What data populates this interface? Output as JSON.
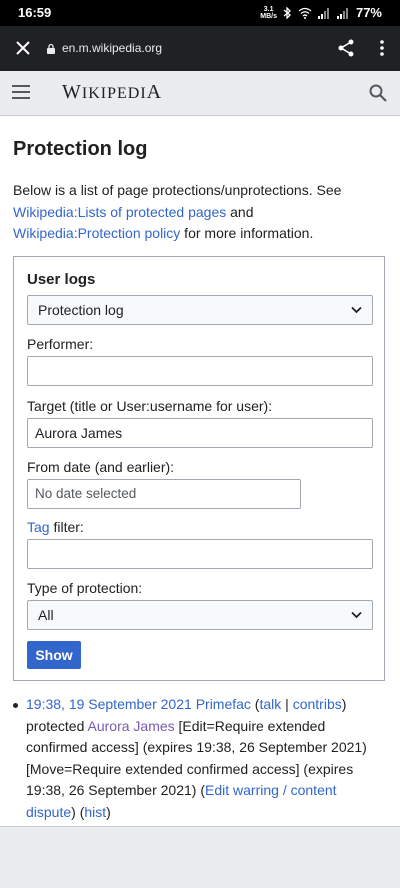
{
  "status_bar": {
    "time": "16:59",
    "net_speed_top": "3.1",
    "net_speed_bottom": "MB/s",
    "battery": "77%"
  },
  "browser": {
    "url": "en.m.wikipedia.org",
    "icons": [
      "close-icon",
      "lock-icon",
      "share-icon",
      "more-vert-icon"
    ]
  },
  "header": {
    "logo_w": "W",
    "logo_rest": "IKIPEDI",
    "logo_a": "A",
    "icons": [
      "hamburger-icon",
      "search-icon"
    ]
  },
  "page": {
    "title": "Protection log",
    "intro_text": "Below is a list of page protections/unprotections. See ",
    "intro_link1": "Wikipedia:Lists of protected pages",
    "intro_and": " and ",
    "intro_link2": "Wikipedia:Protection policy",
    "intro_end": " for more information."
  },
  "form": {
    "legend": "User logs",
    "log_type_value": "Protection log",
    "performer_label": "Performer:",
    "performer_value": "",
    "target_label": "Target (title or User:username for user):",
    "target_value": "Aurora James",
    "date_label": "From date (and earlier):",
    "date_placeholder": "No date selected",
    "tag_link": "Tag",
    "tag_label_rest": " filter:",
    "tag_value": "",
    "protection_label": "Type of protection:",
    "protection_value": "All",
    "show_button": "Show"
  },
  "log_entries": [
    {
      "timestamp": "19:38, 19 September 2021",
      "user": "Primefac",
      "open_paren": " (",
      "talk": "talk",
      "sep": " | ",
      "contribs": "contribs",
      "action": ") protected ",
      "target": "Aurora James",
      "details": " [Edit=Require extended confirmed access] (expires 19:38, 26 September 2021) [Move=Require extended confirmed access] (expires 19:38, 26 September 2021) (",
      "reason": "Edit warring / content dispute",
      "mid": ") (",
      "hist": "hist",
      "end": ")"
    }
  ]
}
